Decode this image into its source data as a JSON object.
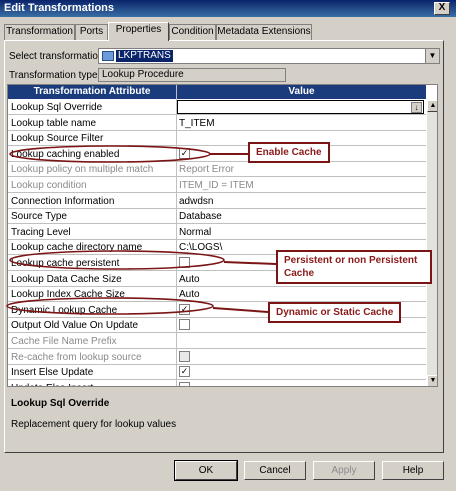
{
  "window": {
    "title": "Edit Transformations",
    "close_label": "X"
  },
  "tabs": [
    {
      "label": "Transformation"
    },
    {
      "label": "Ports"
    },
    {
      "label": "Properties"
    },
    {
      "label": "Condition"
    },
    {
      "label": "Metadata Extensions"
    }
  ],
  "select_transformation": {
    "label": "Select transformation:",
    "value": "LKPTRANS",
    "icon": "lookup-transformation-icon"
  },
  "transformation_type": {
    "label": "Transformation type:",
    "value": "Lookup Procedure"
  },
  "grid": {
    "col_attribute": "Transformation Attribute",
    "col_value": "Value",
    "rows": [
      {
        "name": "Lookup Sql Override",
        "value": "",
        "kind": "sql"
      },
      {
        "name": "Lookup table name",
        "value": "T_ITEM",
        "kind": "text"
      },
      {
        "name": "Lookup Source Filter",
        "value": "",
        "kind": "text"
      },
      {
        "name": "Lookup caching enabled",
        "value": "✓",
        "kind": "checkbox"
      },
      {
        "name": "Lookup policy on multiple match",
        "value": "Report Error",
        "kind": "text",
        "dim": true
      },
      {
        "name": "Lookup condition",
        "value": "ITEM_ID = ITEM",
        "kind": "text",
        "dim": true
      },
      {
        "name": "Connection Information",
        "value": "adwdsn",
        "kind": "text"
      },
      {
        "name": "Source Type",
        "value": "Database",
        "kind": "text"
      },
      {
        "name": "Tracing Level",
        "value": "Normal",
        "kind": "text"
      },
      {
        "name": "Lookup cache directory name",
        "value": "C:\\LOGS\\",
        "kind": "text"
      },
      {
        "name": "Lookup cache persistent",
        "value": "",
        "kind": "checkbox"
      },
      {
        "name": "Lookup Data Cache Size",
        "value": "Auto",
        "kind": "text"
      },
      {
        "name": "Lookup Index Cache Size",
        "value": "Auto",
        "kind": "text"
      },
      {
        "name": "Dynamic Lookup Cache",
        "value": "✓",
        "kind": "checkbox"
      },
      {
        "name": "Output Old Value On Update",
        "value": "",
        "kind": "checkbox"
      },
      {
        "name": "Cache File Name Prefix",
        "value": "",
        "kind": "text",
        "dim": true
      },
      {
        "name": "Re-cache from lookup source",
        "value": "",
        "kind": "checkbox",
        "dim": true
      },
      {
        "name": "Insert Else Update",
        "value": "✓",
        "kind": "checkbox"
      },
      {
        "name": "Update Else Insert",
        "value": "",
        "kind": "checkbox"
      }
    ]
  },
  "description": {
    "title": "Lookup Sql Override",
    "text": "Replacement query for lookup values"
  },
  "buttons": {
    "ok": "OK",
    "cancel": "Cancel",
    "apply": "Apply",
    "help": "Help"
  },
  "annotations": {
    "enable_cache": "Enable Cache",
    "persistent_line1": "Persistent or non Persistent",
    "persistent_line2": "Cache",
    "dynamic": "Dynamic or Static Cache",
    "color": "#7b1414"
  }
}
